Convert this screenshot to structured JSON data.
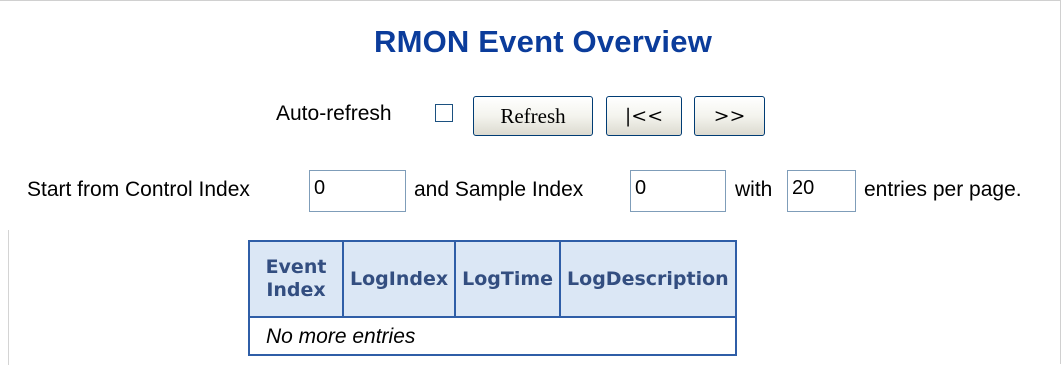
{
  "page": {
    "title": "RMON Event Overview"
  },
  "toolbar": {
    "auto_refresh_label": "Auto-refresh",
    "auto_refresh_checked": false,
    "refresh_label": "Refresh",
    "prev_label": "|<<",
    "next_label": ">>"
  },
  "index_row": {
    "start_label": "Start from Control Index",
    "control_index_value": "0",
    "and_label": "and Sample Index",
    "sample_index_value": "0",
    "with_label": "with",
    "entries_value": "20",
    "entries_label": "entries per page."
  },
  "table": {
    "headers": [
      "Event Index",
      "LogIndex",
      "LogTime",
      "LogDescription"
    ],
    "empty_message": "No more entries"
  },
  "colors": {
    "title": "#0b3c9b",
    "table_border": "#2f5ea7",
    "header_bg": "#dbe7f5",
    "header_text": "#334e80"
  }
}
